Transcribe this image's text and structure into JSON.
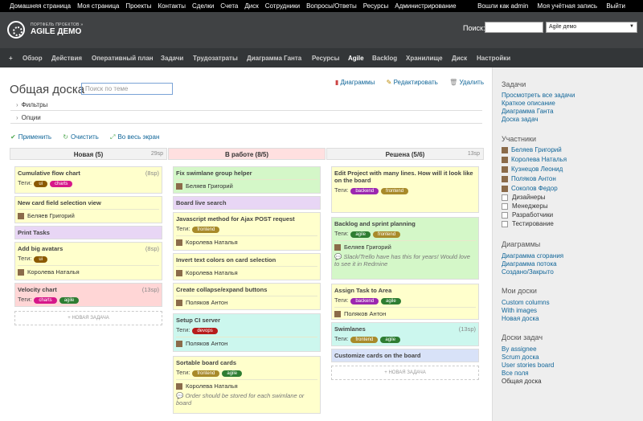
{
  "top_menu": {
    "left": [
      "Домашняя страница",
      "Моя страница",
      "Проекты",
      "Контакты",
      "Сделки",
      "Счета",
      "Диск",
      "Сотрудники",
      "Вопросы/Ответы",
      "Ресурсы",
      "Администрирование"
    ],
    "logged_in_prefix": "Вошли как",
    "user": "admin",
    "account": "Моя учётная запись",
    "logout": "Выйти"
  },
  "header": {
    "brand_small": "ПОРТФЕЛЬ ПРОЕКТОВ »",
    "brand": "AGILE ДЕМО",
    "search_label": "Поиск:",
    "project_select": "Agile демо"
  },
  "main_menu": [
    "+",
    "Обзор",
    "Действия",
    "Оперативный план",
    "Задачи",
    "Трудозатраты",
    "Диаграмма Ганта",
    "Ресурсы",
    "Agile",
    "Backlog",
    "Хранилище",
    "Диск",
    "Настройки"
  ],
  "page": {
    "title": "Общая доска",
    "search_placeholder": "Поиск по теме",
    "diagrams": "Диаграммы",
    "edit": "Редактировать",
    "delete": "Удалить",
    "filters": "Фильтры",
    "options": "Опции",
    "apply": "Применить",
    "clear": "Очистить",
    "fullscreen": "Во весь экран",
    "tags_label": "Теги:",
    "new_task": "+ НОВАЯ ЗАДАЧА"
  },
  "columns": [
    {
      "name": "Новая (5)",
      "sp": "29sp",
      "cards": [
        {
          "title": "Cumulative flow chart",
          "sp": "(8sp)",
          "tags": [
            "ui",
            "charts"
          ],
          "user": "",
          "note": ""
        },
        {
          "title": "New card field selection view",
          "sp": "",
          "tags": [],
          "user": "Беляев Григорий",
          "note": ""
        },
        {
          "title": "Print Tasks",
          "sp": "",
          "tags": [],
          "user": "",
          "note": ""
        },
        {
          "title": "Add big avatars",
          "sp": "(8sp)",
          "tags": [
            "ui"
          ],
          "user": "Королева Наталья",
          "note": ""
        },
        {
          "title": "Velocity chart",
          "sp": "(13sp)",
          "tags": [
            "charts",
            "agile"
          ],
          "user": "",
          "note": ""
        }
      ]
    },
    {
      "name": "В работе (8/5)",
      "sp": "",
      "cards": [
        {
          "title": "Fix swimlane group helper",
          "sp": "",
          "tags": [],
          "user": "Беляев Григорий",
          "note": ""
        },
        {
          "title": "Board live search",
          "sp": "",
          "tags": [],
          "user": "",
          "note": ""
        },
        {
          "title": "Javascript method for Ajax POST request",
          "sp": "",
          "tags": [
            "frontend"
          ],
          "user": "Королева Наталья",
          "note": ""
        },
        {
          "title": "Invert text colors on card selection",
          "sp": "",
          "tags": [],
          "user": "Королева Наталья",
          "note": ""
        },
        {
          "title": "Create collapse/expand buttons",
          "sp": "",
          "tags": [],
          "user": "Поляков Антон",
          "note": ""
        },
        {
          "title": "Setup CI server",
          "sp": "",
          "tags": [
            "devops"
          ],
          "user": "Поляков Антон",
          "note": ""
        },
        {
          "title": "Sortable board cards",
          "sp": "",
          "tags": [
            "frontend",
            "agile"
          ],
          "user": "Королева Наталья",
          "note": "Order should be stored for each swimlane or board"
        }
      ]
    },
    {
      "name": "Решена (5/6)",
      "sp": "13sp",
      "cards": [
        {
          "title": "Edit Project with many lines. How will it look like on the board",
          "sp": "",
          "tags": [
            "backend",
            "frontend"
          ],
          "user": "",
          "note": ""
        },
        {
          "title": "Backlog and sprint planning",
          "sp": "",
          "tags": [
            "agile",
            "frontend"
          ],
          "user": "Беляев Григорий",
          "note": "Slack/Trello have has this for years! Would love to see it in Redmine"
        },
        {
          "title": "Assign Task to Area",
          "sp": "",
          "tags": [
            "backend",
            "agile"
          ],
          "user": "Поляков Антон",
          "note": ""
        },
        {
          "title": "Swimlanes",
          "sp": "(13sp)",
          "tags": [
            "frontend",
            "agile"
          ],
          "user": "",
          "note": ""
        },
        {
          "title": "Customize cards on the board",
          "sp": "",
          "tags": [],
          "user": "",
          "note": ""
        }
      ]
    }
  ],
  "tag_colors": {
    "ui": "#8b5a00",
    "charts": "#d6188a",
    "agile": "#2e7d32",
    "frontend": "#a88a2a",
    "backend": "#9c27b0",
    "devops": "#b71c1c"
  },
  "sidebar": {
    "tasks_h": "Задачи",
    "tasks": [
      "Просмотреть все задачи",
      "Краткое описание",
      "Диаграмма Ганта",
      "Доска задач"
    ],
    "members_h": "Участники",
    "members": [
      "Беляев Григорий",
      "Королева Наталья",
      "Кузнецов Леонид",
      "Поляков Антон",
      "Соколов Федор"
    ],
    "roles": [
      "Дизайнеры",
      "Менеджеры",
      "Разработчики",
      "Тестирование"
    ],
    "charts_h": "Диаграммы",
    "charts": [
      "Диаграмма сгорания",
      "Диаграмма потока",
      "Создано/Закрыто"
    ],
    "myboards_h": "Мои доски",
    "myboards": [
      "Custom columns",
      "With images",
      "Новая доска"
    ],
    "boards_h": "Доски задач",
    "boards": [
      "By assignee",
      "Scrum доска",
      "User stories board",
      "Все поля"
    ],
    "boards_current": "Общая доска"
  }
}
